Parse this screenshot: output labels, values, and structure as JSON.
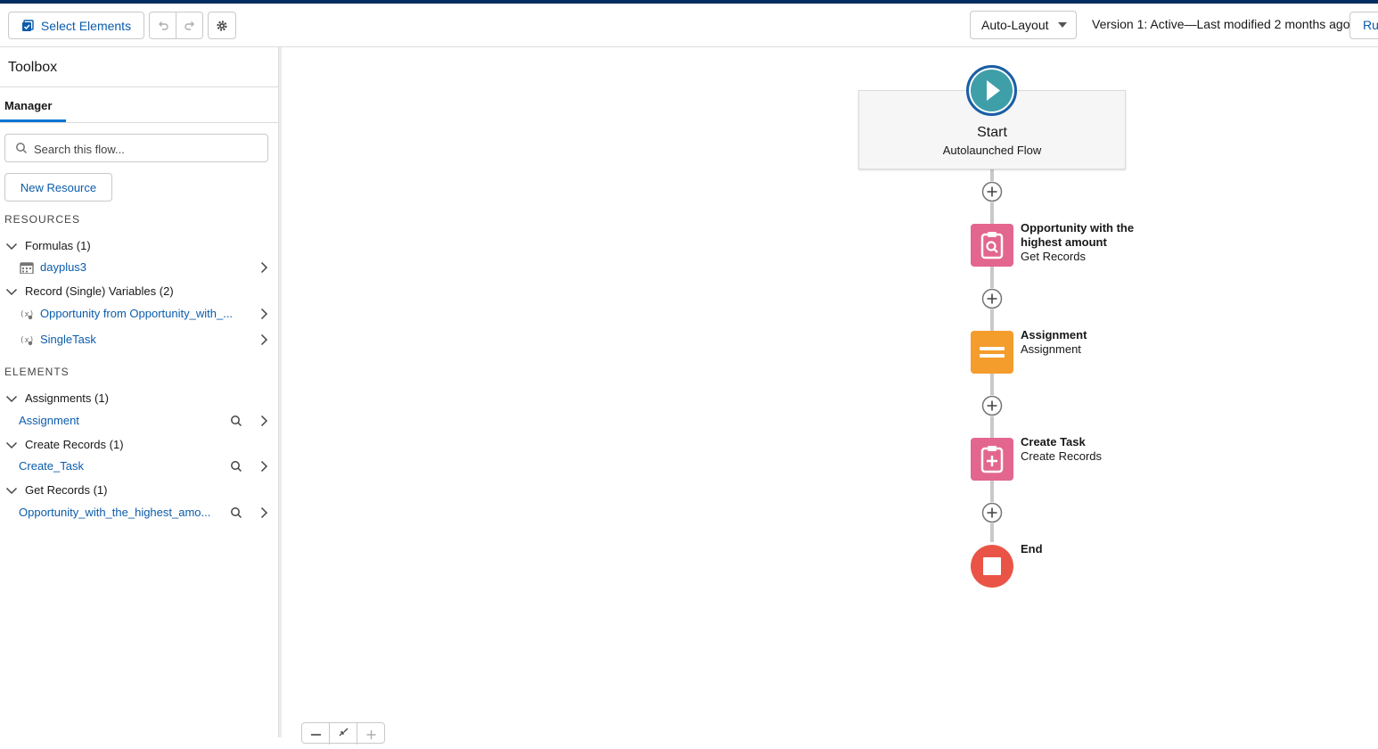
{
  "toolbar": {
    "select_elements": "Select Elements",
    "layout_mode": "Auto-Layout",
    "version_status": "Version 1: Active—Last modified 2 months ago",
    "run_label": "Run"
  },
  "toolbox": {
    "title": "Toolbox",
    "tab": "Manager",
    "search_placeholder": "Search this flow...",
    "new_resource": "New Resource",
    "resources_heading": "RESOURCES",
    "elements_heading": "ELEMENTS",
    "resources": [
      {
        "group": "Formulas (1)",
        "items": [
          {
            "label": "dayplus3",
            "icon": "calendar-icon"
          }
        ]
      },
      {
        "group": "Record (Single) Variables (2)",
        "items": [
          {
            "label": "Opportunity from Opportunity_with_...",
            "icon": "variable-icon"
          },
          {
            "label": "SingleTask",
            "icon": "variable-icon"
          }
        ]
      }
    ],
    "elements": [
      {
        "group": "Assignments (1)",
        "items": [
          {
            "label": "Assignment"
          }
        ]
      },
      {
        "group": "Create Records (1)",
        "items": [
          {
            "label": "Create_Task"
          }
        ]
      },
      {
        "group": "Get Records (1)",
        "items": [
          {
            "label": "Opportunity_with_the_highest_amo..."
          }
        ]
      }
    ]
  },
  "flow": {
    "start": {
      "title": "Start",
      "subtitle": "Autolaunched Flow"
    },
    "nodes": [
      {
        "title": "Opportunity with the highest amount",
        "type": "Get Records",
        "color": "#e3668f"
      },
      {
        "title": "Assignment",
        "type": "Assignment",
        "color": "#f49c2c"
      },
      {
        "title": "Create Task",
        "type": "Create Records",
        "color": "#e3668f"
      }
    ],
    "end": {
      "title": "End",
      "color": "#ea5446"
    }
  },
  "colors": {
    "accent": "#0176d3",
    "link": "#0b5cab",
    "start": "#3e9fa8"
  }
}
